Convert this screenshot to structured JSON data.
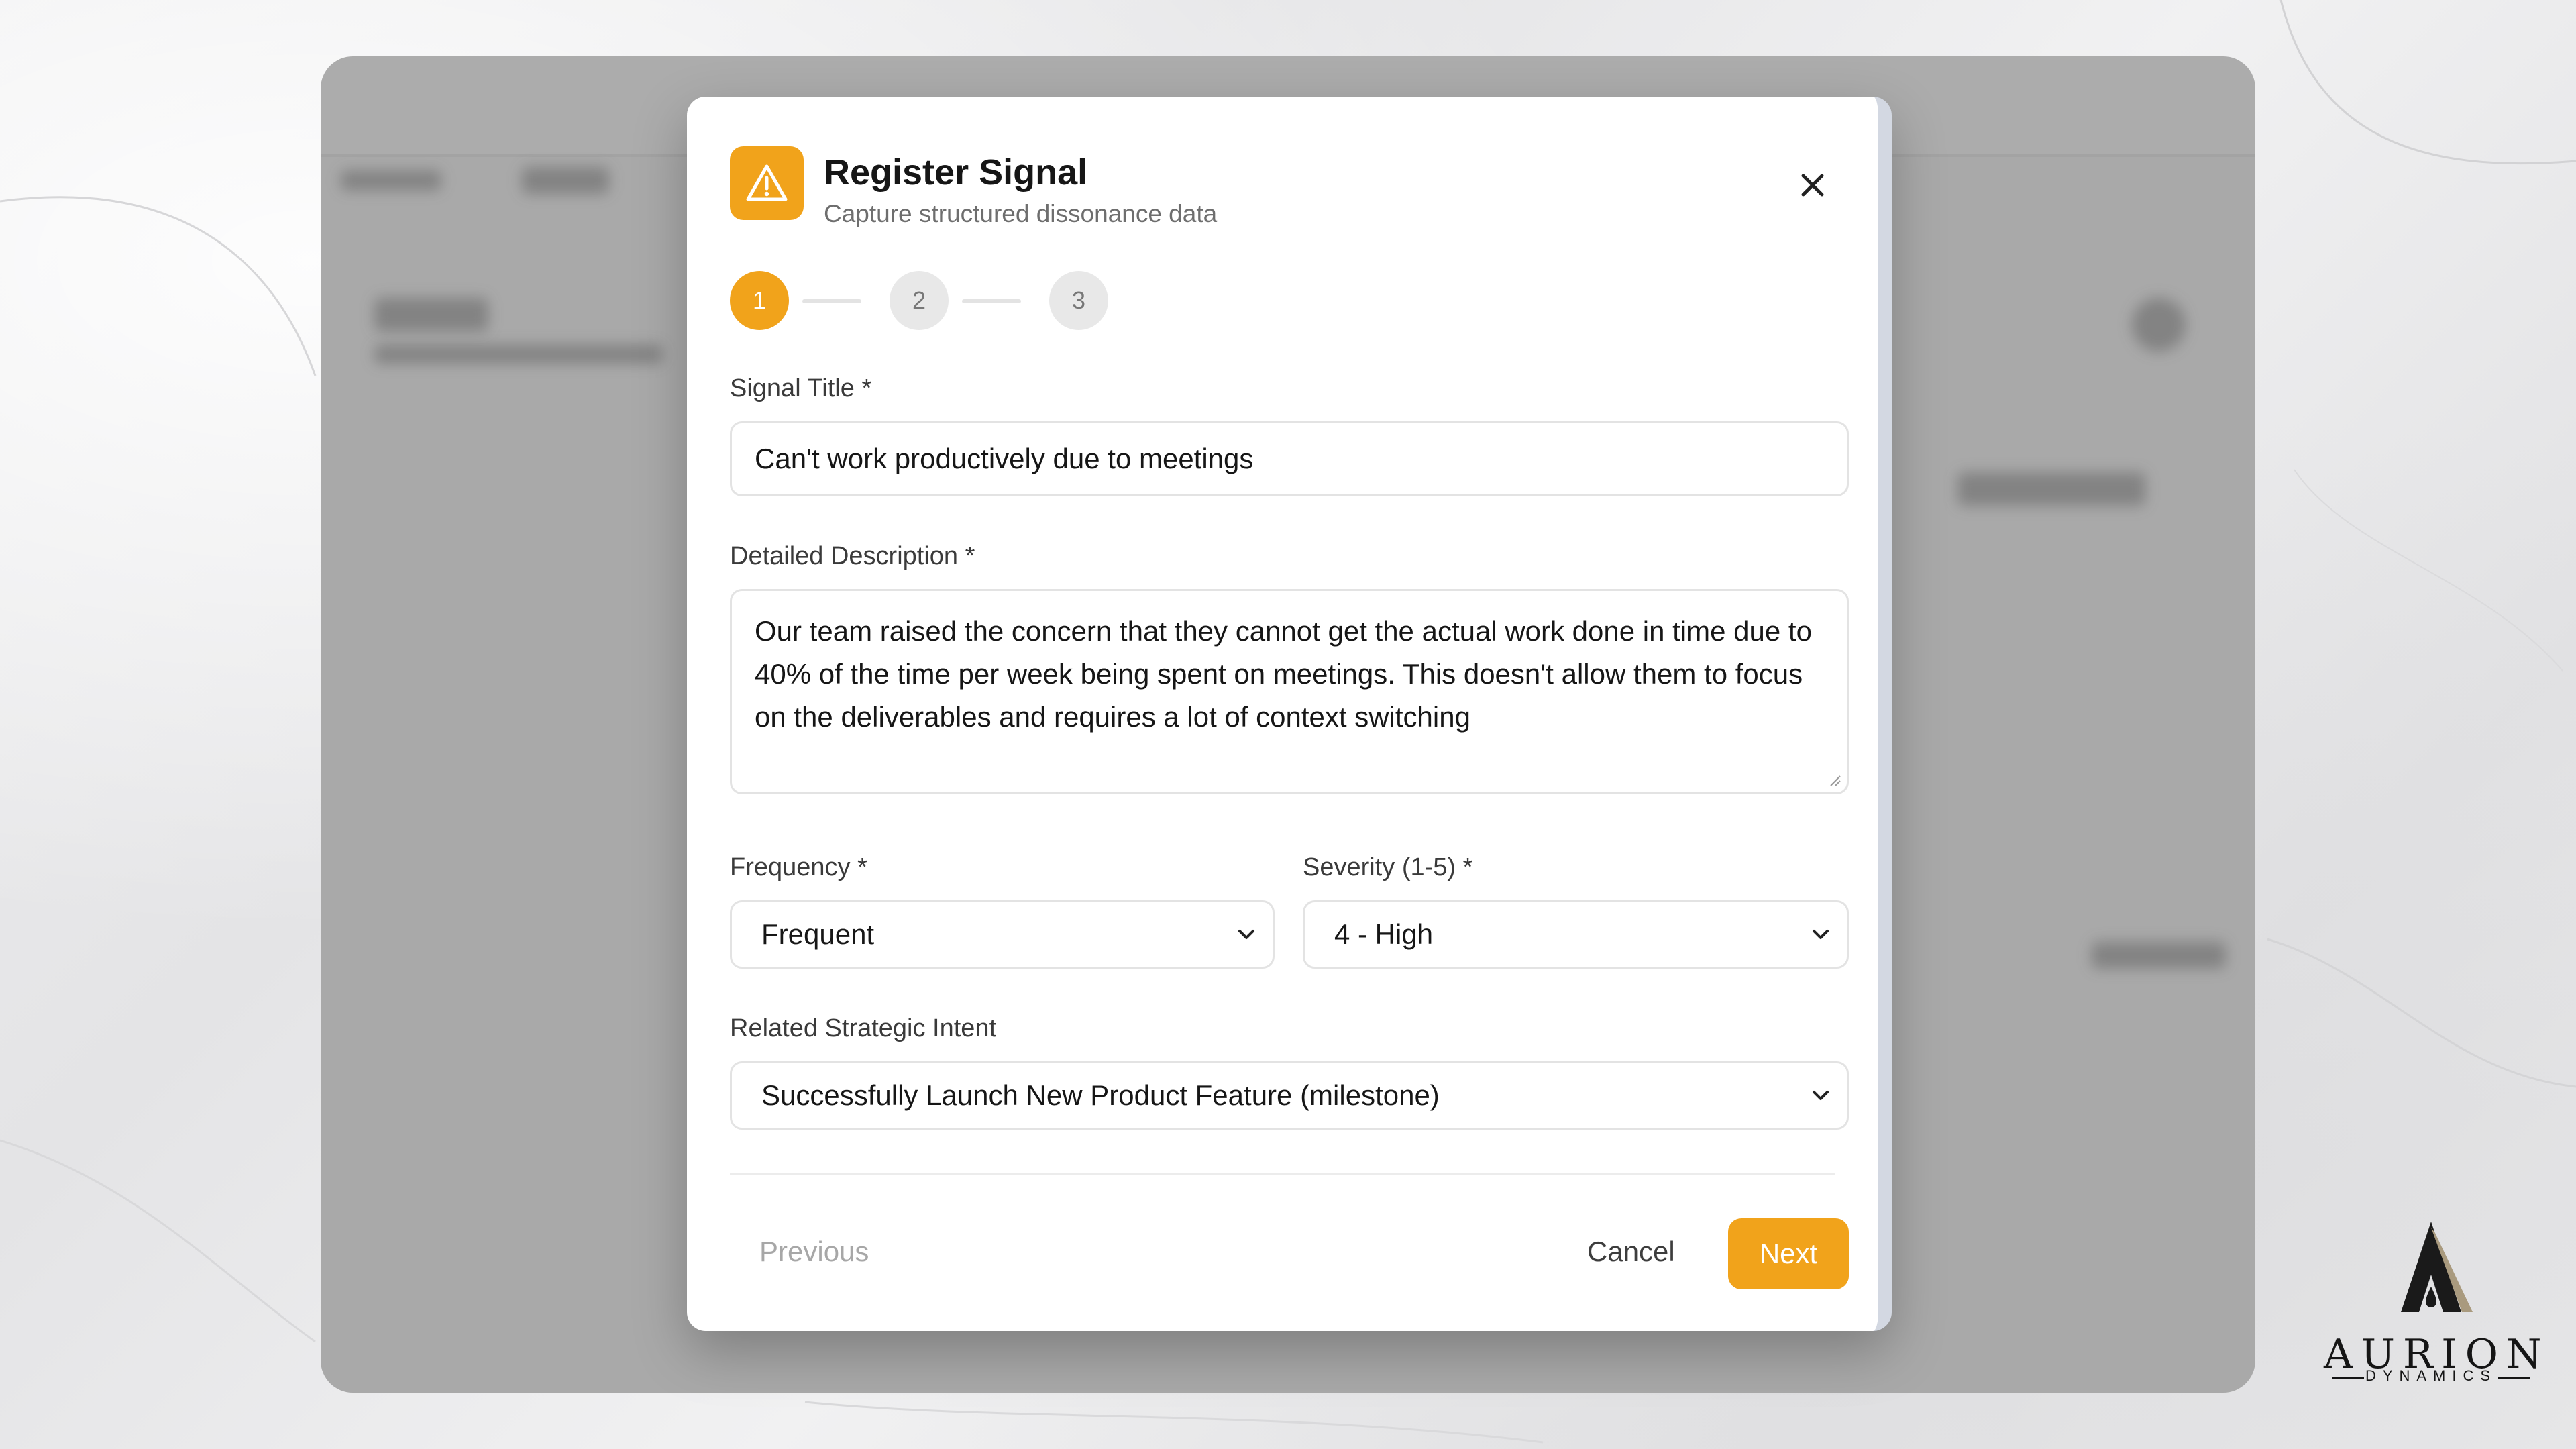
{
  "modal": {
    "title": "Register Signal",
    "subtitle": "Capture structured dissonance data",
    "icon": "warning-triangle-icon",
    "accent_color": "#f1a31b"
  },
  "stepper": {
    "steps": [
      "1",
      "2",
      "3"
    ],
    "active_step": 1
  },
  "form": {
    "signal_title": {
      "label": "Signal Title *",
      "value": "Can't work productively due to meetings"
    },
    "description": {
      "label": "Detailed Description *",
      "value": "Our team raised the concern that they cannot get the actual work done in time due to 40% of the time per week being spent on meetings. This doesn't allow them to focus on the deliverables and requires a lot of context switching"
    },
    "frequency": {
      "label": "Frequency *",
      "value": "Frequent"
    },
    "severity": {
      "label": "Severity (1-5) *",
      "value": "4 - High"
    },
    "strategic_intent": {
      "label": "Related Strategic Intent",
      "value": "Successfully Launch New Product Feature (milestone)"
    }
  },
  "footer": {
    "previous_label": "Previous",
    "cancel_label": "Cancel",
    "next_label": "Next"
  },
  "brand": {
    "name": "AURION",
    "tagline": "DYNAMICS"
  }
}
